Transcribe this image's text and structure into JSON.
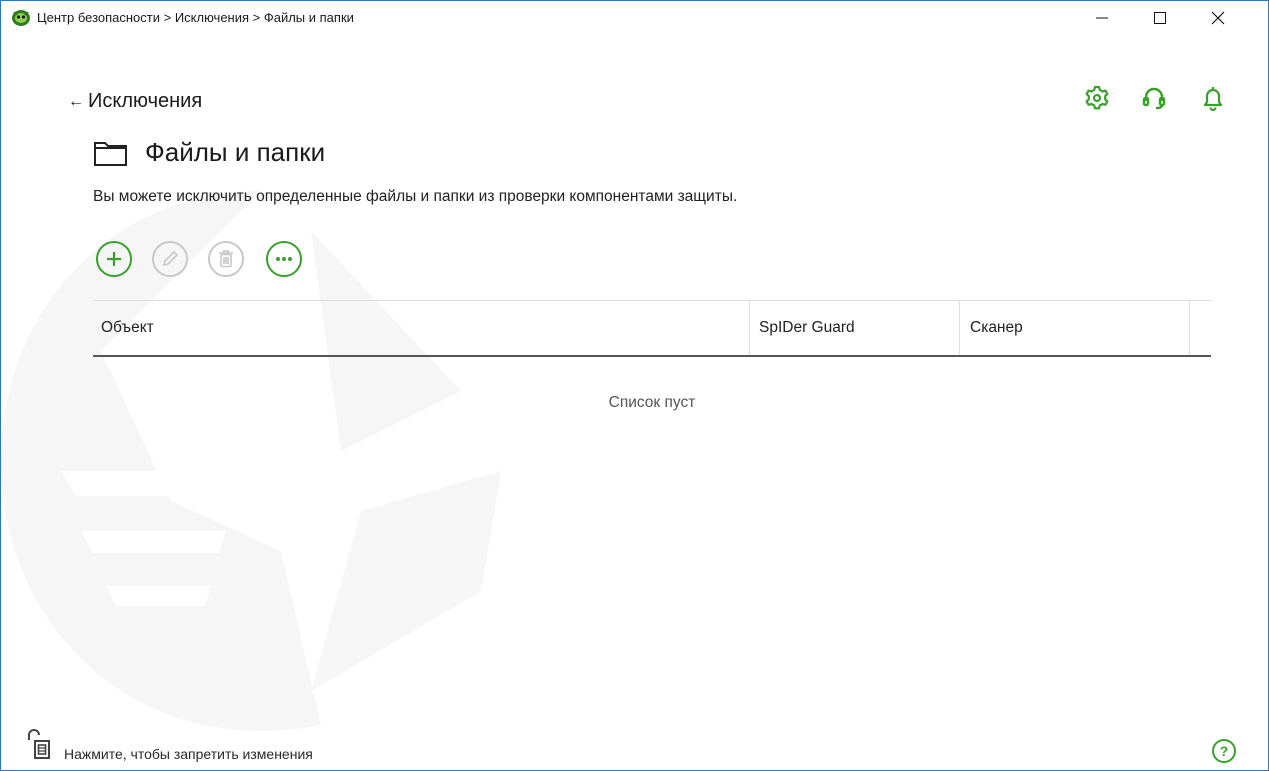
{
  "window": {
    "title": "Центр безопасности > Исключения > Файлы и папки",
    "controls": {
      "minimize": "minimize",
      "maximize": "maximize",
      "close": "close"
    }
  },
  "header": {
    "back_label": "Исключения",
    "page_title": "Файлы и папки",
    "description": "Вы можете исключить определенные файлы и папки из проверки компонентами защиты.",
    "icons": [
      "gear-icon",
      "headset-icon",
      "bell-icon"
    ]
  },
  "toolbar": {
    "buttons": [
      {
        "name": "add",
        "icon": "plus-icon",
        "enabled": true
      },
      {
        "name": "edit",
        "icon": "pencil-icon",
        "enabled": false
      },
      {
        "name": "delete",
        "icon": "trash-icon",
        "enabled": false
      },
      {
        "name": "more",
        "icon": "ellipsis-icon",
        "enabled": true
      }
    ]
  },
  "table": {
    "columns": [
      "Объект",
      "SpIDer Guard",
      "Сканер"
    ],
    "rows": [],
    "empty_message": "Список пуст"
  },
  "footer": {
    "lock_text": "Нажмите, чтобы запретить изменения",
    "help_label": "?"
  },
  "colors": {
    "accent": "#3aa02c",
    "disabled": "#c8c8c8",
    "window_border": "#2b79c6"
  }
}
